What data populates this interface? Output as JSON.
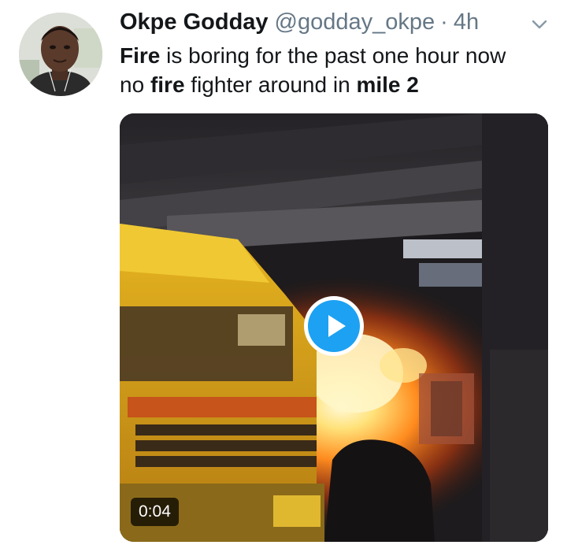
{
  "tweet": {
    "author_name": "Okpe Godday",
    "handle": "@godday_okpe",
    "separator": "·",
    "time": "4h",
    "text_segments": [
      {
        "text": "Fire",
        "bold": true
      },
      {
        "text": " is boring for the past one hour now ",
        "bold": false
      },
      {
        "text": "no ",
        "bold": false
      },
      {
        "text": "fire",
        "bold": true
      },
      {
        "text": " fighter around in ",
        "bold": false
      },
      {
        "text": "mile 2",
        "bold": true
      }
    ],
    "media": {
      "type": "video",
      "duration": "0:04",
      "play_icon": "play-icon",
      "accent_color": "#1da1f2"
    },
    "menu_icon": "chevron-down-icon"
  },
  "colors": {
    "text_primary": "#14171a",
    "text_secondary": "#657786",
    "accent": "#1da1f2"
  }
}
